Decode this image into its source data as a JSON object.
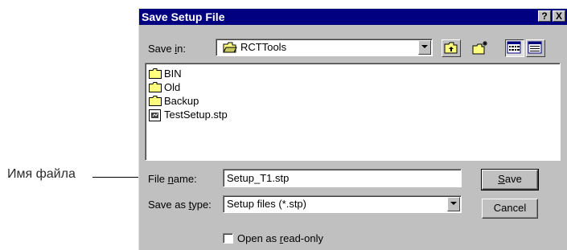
{
  "annotation": {
    "label": "Имя файла"
  },
  "dialog": {
    "title": "Save Setup File",
    "help_button": "?",
    "close_button": "X",
    "save_in": {
      "label_pre": "Save ",
      "label_key": "i",
      "label_post": "n:",
      "value": "RCTTools"
    },
    "files": [
      {
        "name": "BIN",
        "icon": "folder-icon"
      },
      {
        "name": "Old",
        "icon": "folder-icon"
      },
      {
        "name": "Backup",
        "icon": "folder-icon"
      },
      {
        "name": "TestSetup.stp",
        "icon": "document-icon"
      }
    ],
    "file_name": {
      "label_pre": "File ",
      "label_key": "n",
      "label_post": "ame:",
      "value": "Setup_T1.stp"
    },
    "save_as_type": {
      "label_pre": "Save as ",
      "label_key": "t",
      "label_post": "ype:",
      "value": "Setup files (*.stp)"
    },
    "read_only": {
      "label_pre": "Open as ",
      "label_key": "r",
      "label_post": "ead-only",
      "checked": false
    },
    "save_button": {
      "key": "S",
      "rest": "ave"
    },
    "cancel_button": "Cancel"
  },
  "colors": {
    "titlebar": "#000080",
    "face": "#c0c0c0",
    "folder": "#ffff80"
  }
}
